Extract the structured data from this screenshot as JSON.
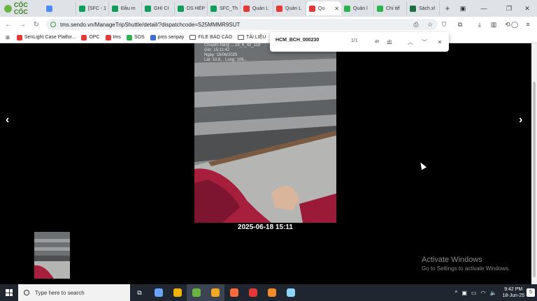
{
  "browser": {
    "brand": "CỐC CỐC",
    "tabs": [
      {
        "label": "",
        "color": "#4c8bf5"
      },
      {
        "label": "[SFC - 1",
        "color": "#0f9d58"
      },
      {
        "label": "Đầu m",
        "color": "#0f9d58"
      },
      {
        "label": "GHI CI",
        "color": "#0f9d58"
      },
      {
        "label": "DS HÉP",
        "color": "#0f9d58"
      },
      {
        "label": "SFC_Th",
        "color": "#0f9d58"
      },
      {
        "label": "Quản L",
        "color": "#e53935"
      },
      {
        "label": "Quản L",
        "color": "#e53935"
      },
      {
        "label": "Qu",
        "color": "#e53935",
        "active": true
      },
      {
        "label": "Quản l",
        "color": "#2bb24c"
      },
      {
        "label": "Chi tiế",
        "color": "#2bb24c"
      },
      {
        "label": "Sách.xl",
        "color": "#1d6f42"
      }
    ],
    "url": "tms.sendo.vn/ManageTripShuttle/detail/?dispatchcode=S25MMMR9SUT",
    "bookmarks": [
      {
        "label": "SenLight Case Platfor...",
        "color": "#e53935"
      },
      {
        "label": "OPC",
        "color": "#e53935"
      },
      {
        "label": "tms",
        "color": "#e53935"
      },
      {
        "label": "SOS",
        "color": "#2bb24c"
      },
      {
        "label": "pms senpay",
        "color": "#3a6fd8"
      },
      {
        "label": "FILE BÁO CÁO",
        "folder": true
      },
      {
        "label": "TÀI LIỆU",
        "folder": true
      },
      {
        "label": "FIL",
        "folder": true
      }
    ]
  },
  "find": {
    "query": "HCM_BCH_000230",
    "count": "1/1",
    "match_case": "ab",
    "whole_word": "ab"
  },
  "viewer": {
    "stamp_lines": [
      "Chuyến hàng ... 29_6_42_118",
      "Giờ: 15:11:42",
      "Ngày: 18/06/2025",
      "Lat: 10.8... Long: 106..."
    ],
    "caption": "2025-06-18 15:11",
    "prev": "‹",
    "next": "›"
  },
  "watermark": {
    "title": "Activate Windows",
    "subtitle": "Go to Settings to activate Windows."
  },
  "taskbar": {
    "search_placeholder": "Type here to search",
    "time": "9:42 PM",
    "date": "18-Jun-25",
    "notification_count": "5",
    "apps": [
      "#6aa3ff",
      "#f0b400",
      "#6bb43f",
      "#f5a623",
      "#ff6a3d",
      "#e53935",
      "#f28c28",
      "#8fd3ff"
    ]
  }
}
